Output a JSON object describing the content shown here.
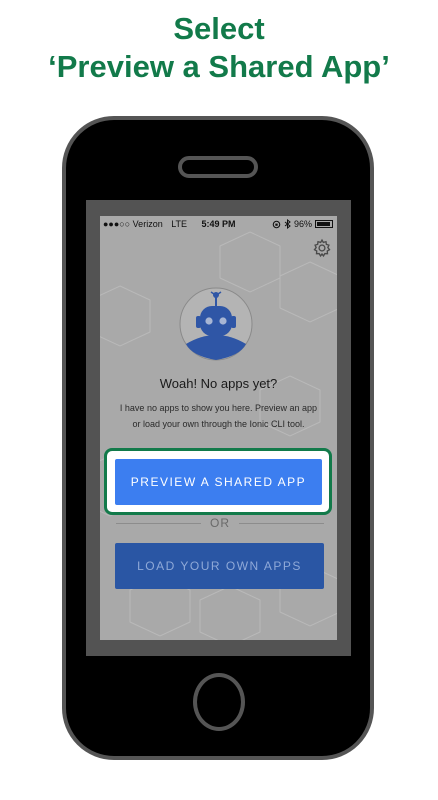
{
  "headline": {
    "line1": "Select",
    "line2": "‘Preview a Shared App’"
  },
  "status_bar": {
    "carrier": "●●●○○ Verizon",
    "network": "LTE",
    "time": "5:49 PM",
    "battery": "96%",
    "battery_level": 0.96
  },
  "app": {
    "settings_icon": "gear-icon",
    "empty_title": "Woah! No apps yet?",
    "empty_desc_line1": "I have no apps to show you here. Preview an app",
    "empty_desc_line2": "or load your own through the Ionic CLI tool.",
    "preview_button": "PREVIEW A SHARED APP",
    "or_label": "OR",
    "load_button": "LOAD YOUR OWN APPS"
  },
  "colors": {
    "headline": "#127a4a",
    "preview_button": "#3c7ef0",
    "load_button": "#2a56a4",
    "highlight_border": "#127a4a"
  }
}
